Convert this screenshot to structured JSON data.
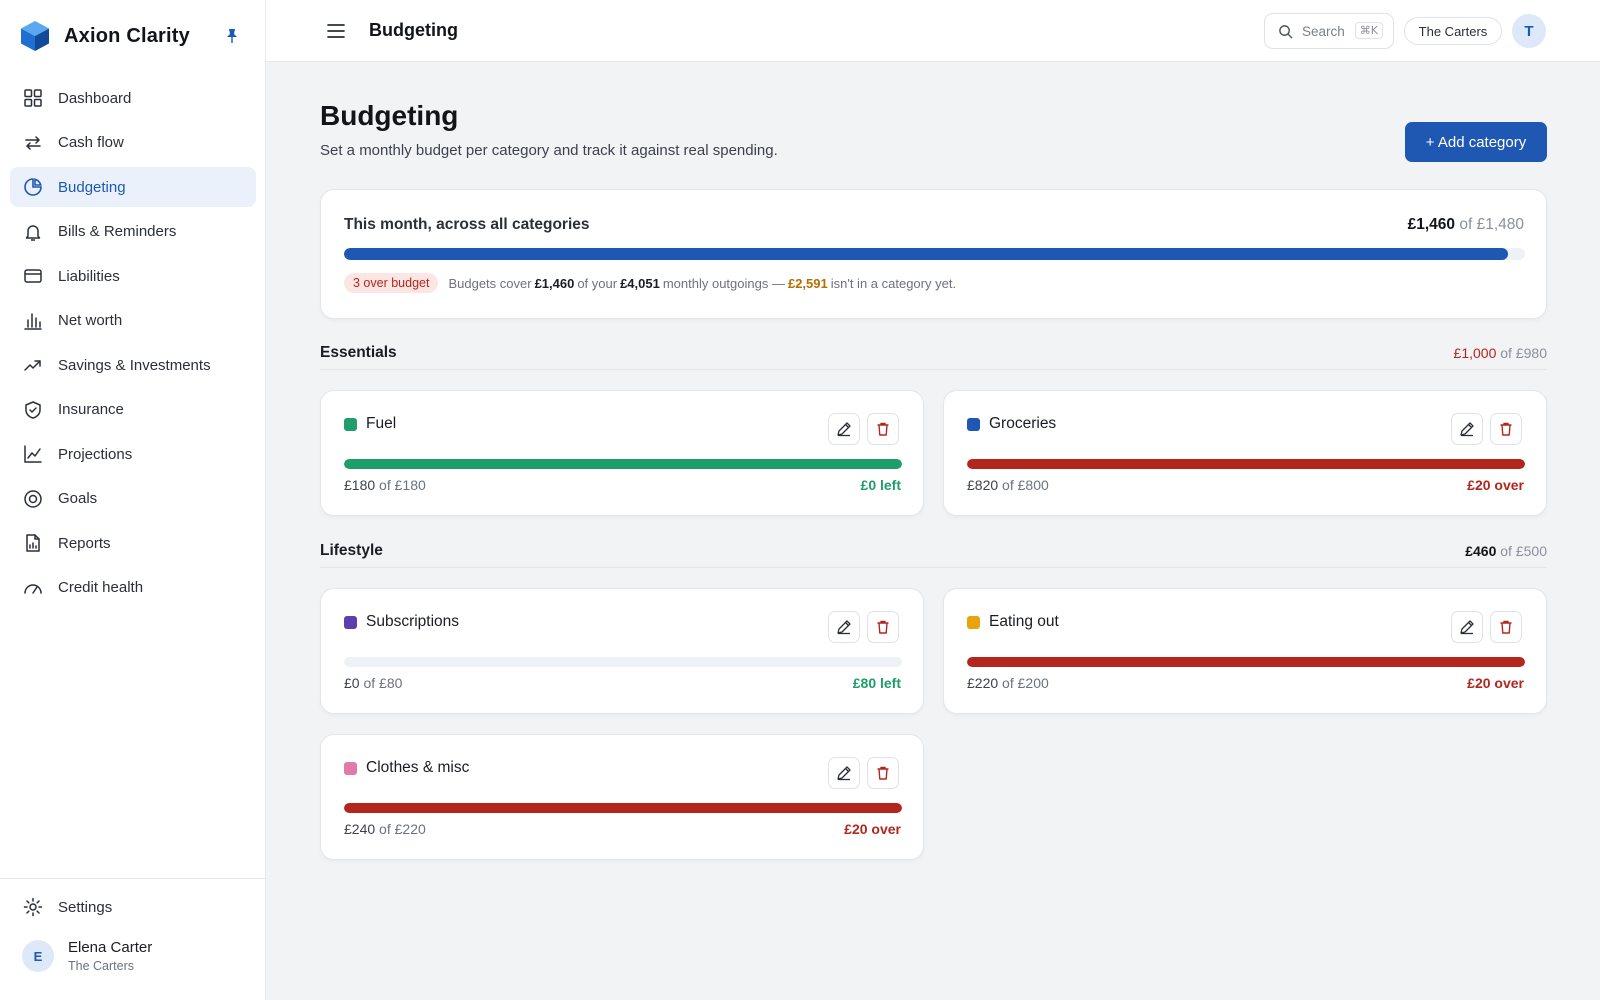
{
  "app": {
    "name": "Axion Clarity"
  },
  "sidebar": {
    "items": [
      {
        "label": "Dashboard",
        "icon": "grid-icon"
      },
      {
        "label": "Cash flow",
        "icon": "arrows-icon"
      },
      {
        "label": "Budgeting",
        "icon": "pie-icon",
        "active": true
      },
      {
        "label": "Bills & Reminders",
        "icon": "bell-icon"
      },
      {
        "label": "Liabilities",
        "icon": "card-icon"
      },
      {
        "label": "Net worth",
        "icon": "bar-chart-icon"
      },
      {
        "label": "Savings & Investments",
        "icon": "trend-icon"
      },
      {
        "label": "Insurance",
        "icon": "shield-icon"
      },
      {
        "label": "Projections",
        "icon": "line-chart-icon"
      },
      {
        "label": "Goals",
        "icon": "target-icon"
      },
      {
        "label": "Reports",
        "icon": "report-icon"
      },
      {
        "label": "Credit health",
        "icon": "gauge-icon"
      }
    ],
    "settings_label": "Settings",
    "user": {
      "initial": "E",
      "name": "Elena Carter",
      "household": "The Carters"
    }
  },
  "topbar": {
    "title": "Budgeting",
    "search_placeholder": "Search",
    "search_shortcut": "⌘K",
    "household": "The Carters",
    "avatar_initial": "T"
  },
  "page": {
    "title": "Budgeting",
    "subtitle": "Set a monthly budget per category and track it against real spending.",
    "add_button": "+ Add category"
  },
  "summary": {
    "title": "This month, across all categories",
    "spent": "£1,460",
    "of_word": "of",
    "budget": "£1,480",
    "progress": 0.986,
    "over_badge": "3 over budget",
    "note_prefix": "Budgets cover",
    "note_covered": "£1,460",
    "note_mid": "of your",
    "note_outgoings": "£4,051",
    "note_mid2": "monthly outgoings —",
    "note_uncategorised": "£2,591",
    "note_suffix": "isn't in a category yet."
  },
  "sections": [
    {
      "name": "Essentials",
      "spent": "£1,000",
      "of_word": "of",
      "budget": "£980",
      "over": true,
      "categories": [
        {
          "name": "Fuel",
          "color": "#1f9d6b",
          "spent": "£180",
          "of_word": "of",
          "budget": "£180",
          "status": "£0 left",
          "over": false,
          "progress": 1.0
        },
        {
          "name": "Groceries",
          "color": "#1f58b2",
          "spent": "£820",
          "of_word": "of",
          "budget": "£800",
          "status": "£20 over",
          "over": true,
          "progress": 1.0
        }
      ]
    },
    {
      "name": "Lifestyle",
      "spent": "£460",
      "of_word": "of",
      "budget": "£500",
      "over": false,
      "categories": [
        {
          "name": "Subscriptions",
          "color": "#5b3fb0",
          "spent": "£0",
          "of_word": "of",
          "budget": "£80",
          "status": "£80 left",
          "over": false,
          "progress": 0
        },
        {
          "name": "Eating out",
          "color": "#e8a30e",
          "spent": "£220",
          "of_word": "of",
          "budget": "£200",
          "status": "£20 over",
          "over": true,
          "progress": 1.0
        },
        {
          "name": "Clothes & misc",
          "color": "#e07aa6",
          "spent": "£240",
          "of_word": "of",
          "budget": "£220",
          "status": "£20 over",
          "over": true,
          "progress": 1.0
        }
      ]
    }
  ],
  "colors": {
    "accent": "#1f58b2",
    "ok": "#1f9d6b",
    "over": "#b3261e",
    "warn": "#b76e00"
  }
}
